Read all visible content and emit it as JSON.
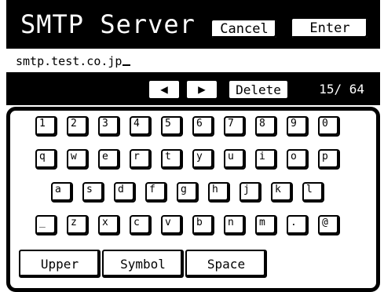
{
  "header": {
    "title": "SMTP Server",
    "cancel_label": "Cancel",
    "enter_label": "Enter"
  },
  "input": {
    "value": "smtp.test.co.jp"
  },
  "controls": {
    "left_icon": "left-arrow-icon",
    "right_icon": "right-arrow-icon",
    "left_glyph": "◀",
    "right_glyph": "▶",
    "delete_label": "Delete",
    "counter": "15/ 64"
  },
  "keyboard": {
    "row1": [
      "1",
      "2",
      "3",
      "4",
      "5",
      "6",
      "7",
      "8",
      "9",
      "0"
    ],
    "row2": [
      "q",
      "w",
      "e",
      "r",
      "t",
      "y",
      "u",
      "i",
      "o",
      "p"
    ],
    "row3": [
      "a",
      "s",
      "d",
      "f",
      "g",
      "h",
      "j",
      "k",
      "l"
    ],
    "row4": [
      "_",
      "z",
      "x",
      "c",
      "v",
      "b",
      "n",
      "m",
      ".",
      "@"
    ],
    "bottom": {
      "upper_label": "Upper",
      "symbol_label": "Symbol",
      "space_label": "Space"
    }
  }
}
